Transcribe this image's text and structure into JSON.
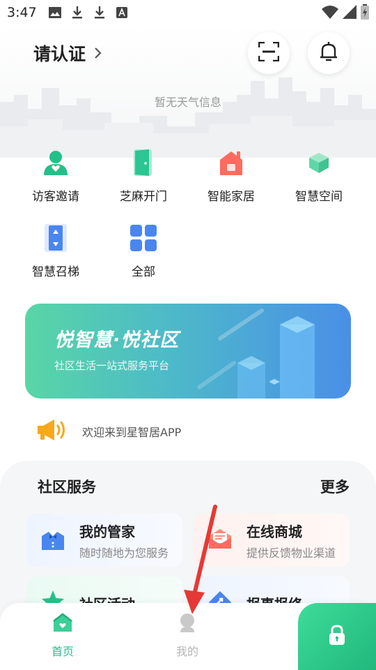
{
  "status_bar": {
    "time": "3:47",
    "icons_left": [
      "image-icon",
      "download-icon",
      "download-icon",
      "font-icon"
    ],
    "icons_right": [
      "wifi-icon",
      "signal-icon",
      "battery-icon"
    ]
  },
  "header": {
    "auth_label": "请认证",
    "scan_icon": "scan-icon",
    "bell_icon": "bell-icon",
    "weather_text": "暂无天气信息"
  },
  "quick_actions": [
    {
      "label": "访客邀请",
      "icon": "visitor-icon",
      "color": "#27c08a"
    },
    {
      "label": "芝麻开门",
      "icon": "door-icon",
      "color": "#2cc594"
    },
    {
      "label": "智能家居",
      "icon": "house-icon",
      "color": "#ff6b5e"
    },
    {
      "label": "智慧空间",
      "icon": "cube-icon",
      "color": "#5fd6a9"
    },
    {
      "label": "智慧召梯",
      "icon": "elevator-icon",
      "color": "#4a86f0"
    },
    {
      "label": "全部",
      "icon": "grid-icon",
      "color": "#4a86f0"
    }
  ],
  "banner": {
    "title": "悦智慧·悦社区",
    "subtitle": "社区生活一站式服务平台"
  },
  "notice": {
    "text": "欢迎来到星智居APP",
    "icon": "megaphone-icon"
  },
  "services": {
    "title": "社区服务",
    "more": "更多",
    "cards": [
      {
        "title": "我的管家",
        "subtitle": "随时随地为您服务",
        "icon": "butler-icon"
      },
      {
        "title": "在线商城",
        "subtitle": "提供反馈物业渠道",
        "icon": "mail-icon"
      },
      {
        "title": "社区活动",
        "subtitle": "",
        "icon": "star-icon"
      },
      {
        "title": "报事报修",
        "subtitle": "",
        "icon": "repair-icon"
      }
    ]
  },
  "tabbar": {
    "home": "首页",
    "mine": "我的",
    "lock_icon": "lock-icon",
    "active_color": "#27c08a",
    "inactive_color": "#b5b5b5"
  }
}
